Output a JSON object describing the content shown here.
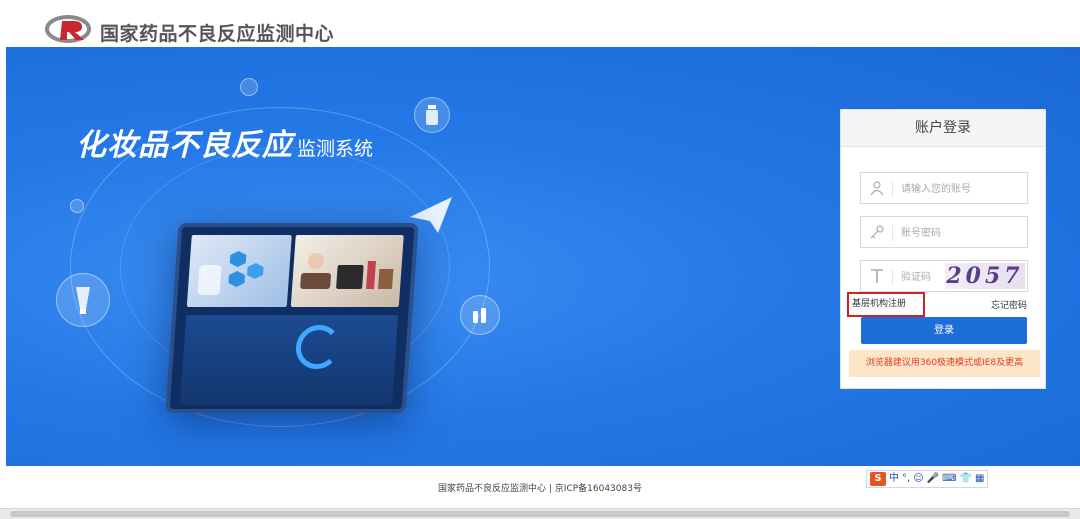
{
  "header": {
    "site_title": "国家药品不良反应监测中心"
  },
  "banner": {
    "title_main": "化妆品不良反应",
    "title_sub": "监测系统"
  },
  "login": {
    "card_title": "账户登录",
    "username_placeholder": "请输入您的账号",
    "password_placeholder": "账号密码",
    "captcha_placeholder": "验证码",
    "captcha_code": "2057",
    "register_link": "基层机构注册",
    "forgot_link": "忘记密码",
    "login_button": "登录",
    "browser_tip": "浏览器建议用360极速模式或IE8及更高"
  },
  "footer": {
    "text": "国家药品不良反应监测中心 | 京ICP备16043083号"
  },
  "ime_toolbar": {
    "items": [
      "S",
      "中",
      "°,",
      "☺",
      "🎤",
      "⌨",
      "👕",
      "▦"
    ]
  },
  "colors": {
    "banner_blue": "#2478e6",
    "login_button": "#1c6ed6",
    "tip_background": "#fde6c8",
    "tip_text": "#e0402a",
    "highlight_border": "#d0212a"
  }
}
